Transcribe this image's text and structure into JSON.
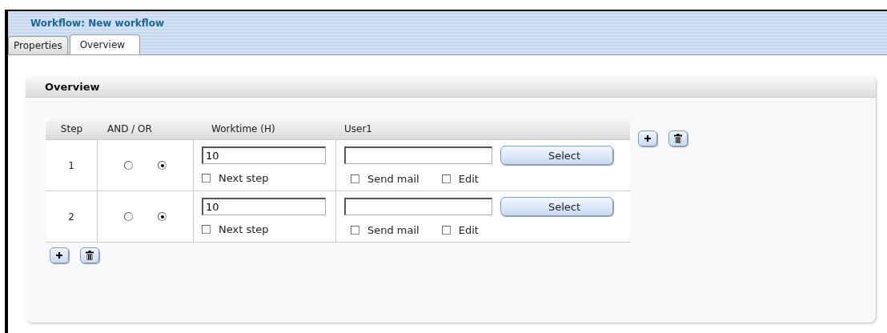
{
  "window": {
    "title": "Workflow: New workflow"
  },
  "tabs": [
    {
      "label": "Properties",
      "selected": false
    },
    {
      "label": "Overview",
      "selected": true
    }
  ],
  "panel": {
    "title": "Overview"
  },
  "table": {
    "columns": [
      "Step",
      "AND / OR",
      "Worktime (H)",
      "User1"
    ],
    "rows": [
      {
        "step": "1",
        "and_or": [
          {
            "selected": false
          },
          {
            "selected": true
          }
        ],
        "worktime": "10",
        "next_step": {
          "label": "Next step",
          "checked": false
        },
        "user": "",
        "select_button": "Select",
        "send_mail": {
          "label": "Send mail",
          "checked": false
        },
        "edit": {
          "label": "Edit",
          "checked": false
        }
      },
      {
        "step": "2",
        "and_or": [
          {
            "selected": false
          },
          {
            "selected": true
          }
        ],
        "worktime": "10",
        "next_step": {
          "label": "Next step",
          "checked": false
        },
        "user": "",
        "select_button": "Select",
        "send_mail": {
          "label": "Send mail",
          "checked": false
        },
        "edit": {
          "label": "Edit",
          "checked": false
        }
      }
    ]
  }
}
